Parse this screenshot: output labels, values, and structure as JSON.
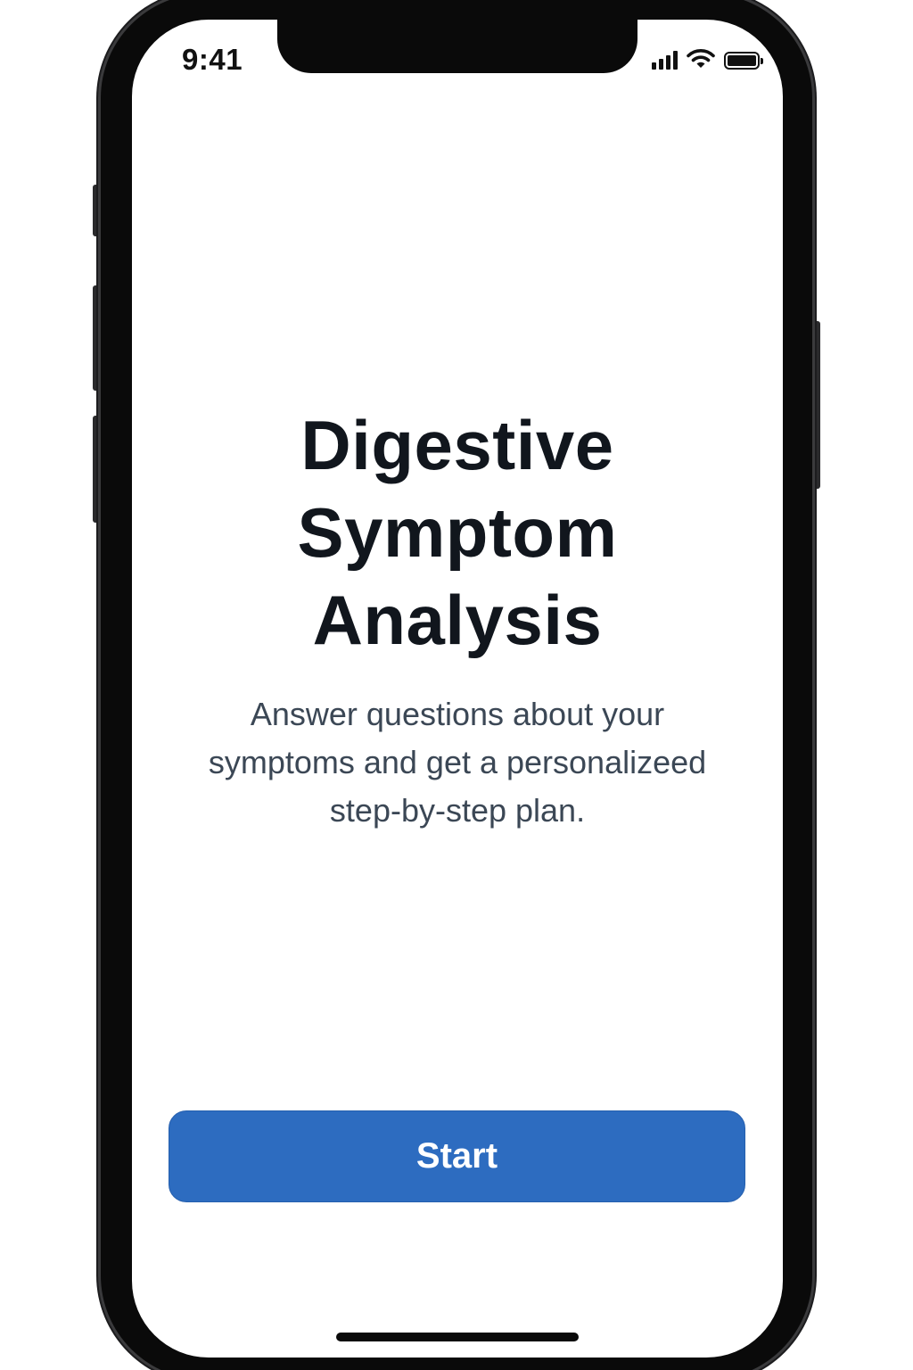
{
  "status_bar": {
    "time": "9:41",
    "signal_icon": "cellular-signal-icon",
    "wifi_icon": "wifi-icon",
    "battery_icon": "battery-icon",
    "battery_level": 1.0
  },
  "main": {
    "title_line1": "Digestive",
    "title_line2": "Symptom",
    "title_line3": "Analysis",
    "subtitle_line1": "Answer questions about your",
    "subtitle_line2": "symptoms and get a personalizeed",
    "subtitle_line3": "step-by-step plan."
  },
  "actions": {
    "start_label": "Start",
    "start_color": "#2d6cc0"
  }
}
